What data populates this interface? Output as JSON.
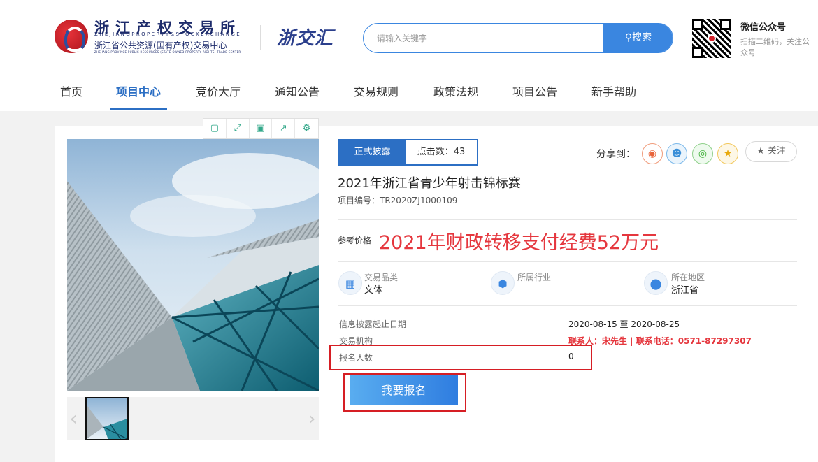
{
  "header": {
    "logo_cn": "浙江产权交易所",
    "logo_en": "ZHEJIANGPROPERTY&STOCKEXCHANGE",
    "logo_sub": "浙江省公共资源(国有产权)交易中心",
    "logo_tiny": "ZHEJIANG PROVINCE PUBLIC RESOURCES (STATE-OWNED PROPERTY RIGHTS) TRADE CENTER",
    "partner_logo": "浙交汇",
    "search_placeholder": "请输入关键字",
    "search_button": "搜索",
    "wechat_title": "微信公众号",
    "wechat_desc": "扫描二维码，关注公众号"
  },
  "nav": {
    "items": [
      "首页",
      "项目中心",
      "竞价大厅",
      "通知公告",
      "交易规则",
      "政策法规",
      "项目公告",
      "新手帮助"
    ],
    "active": "项目中心"
  },
  "project": {
    "status": "正式披露",
    "hits": "点击数：43",
    "share_label": "分享到：",
    "follow": "关注",
    "title": "2021年浙江省青少年射击锦标赛",
    "code": "项目编号：TR2020ZJ1000109",
    "price_label": "参考价格",
    "price": "2021年财政转移支付经费52万元",
    "attrs": [
      {
        "label": "交易品类",
        "value": "文体",
        "icon": "grid-icon"
      },
      {
        "label": "所属行业",
        "value": "",
        "icon": "cube-icon"
      },
      {
        "label": "所在地区",
        "value": "浙江省",
        "icon": "location-pin-icon"
      }
    ],
    "info": {
      "date_label": "信息披露起止日期",
      "date_value": "2020-08-15 至 2020-08-25",
      "org_label": "交易机构",
      "contact": "联系人：宋先生 | 联系电话：0571-87297307",
      "count_label": "报名人数",
      "count_value": "0"
    },
    "register_button": "我要报名"
  },
  "colors": {
    "primary": "#2c6fc4",
    "accent_red": "#e5373e",
    "highlight_box": "#d61e24"
  }
}
